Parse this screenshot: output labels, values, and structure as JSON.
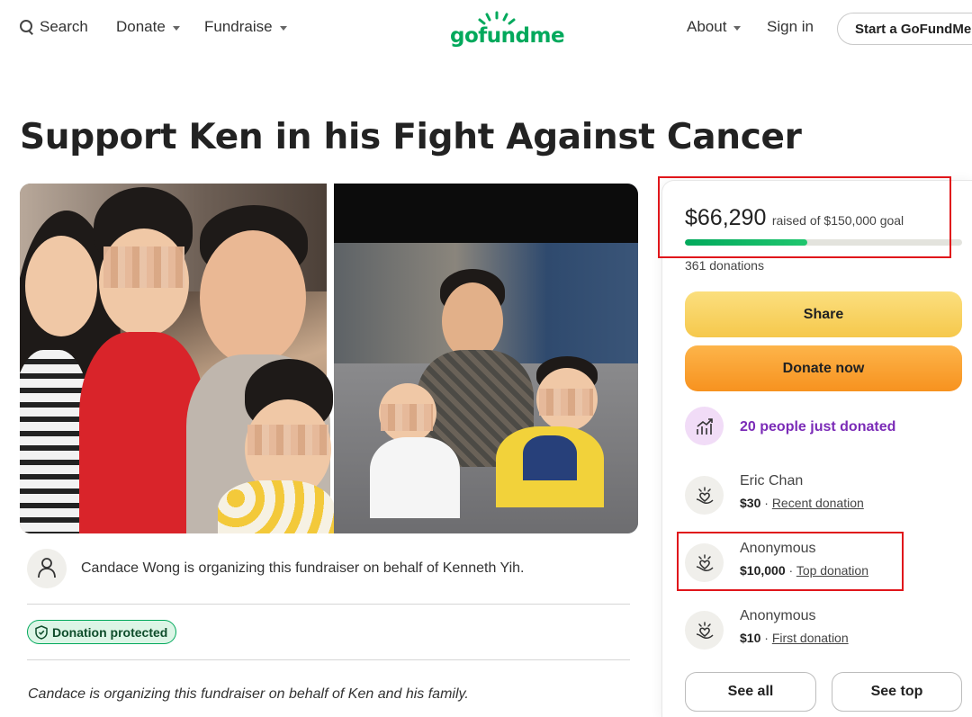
{
  "nav": {
    "search_label": "Search",
    "donate_label": "Donate",
    "fundraise_label": "Fundraise",
    "logo_text": "gofundme",
    "about_label": "About",
    "signin_label": "Sign in",
    "start_label": "Start a GoFundMe"
  },
  "page": {
    "title": "Support Ken in his Fight Against Cancer"
  },
  "organizer": {
    "text": "Candace Wong is organizing this fundraiser on behalf of Kenneth Yih."
  },
  "badge": {
    "label": "Donation protected"
  },
  "story": {
    "intro": "Candace is organizing this fundraiser on behalf of Ken and his family."
  },
  "fundraiser": {
    "raised": "$66,290",
    "raised_label": "raised of $150,000 goal",
    "progress_fraction": 0.442,
    "donations": "361 donations",
    "share_label": "Share",
    "donate_label": "Donate now",
    "just_donated": "20 people just donated"
  },
  "donors": [
    {
      "name": "Eric Chan",
      "amount": "$30",
      "separator": "·",
      "tag": "Recent donation"
    },
    {
      "name": "Anonymous",
      "amount": "$10,000",
      "separator": "·",
      "tag": "Top donation"
    },
    {
      "name": "Anonymous",
      "amount": "$10",
      "separator": "·",
      "tag": "First donation"
    }
  ],
  "footer_buttons": {
    "see_all": "See all",
    "see_top": "See top"
  },
  "colors": {
    "brand_green": "#02a95c",
    "share_yellow": "#f6c84c",
    "donate_orange": "#f7921f",
    "purple": "#7b2bb7",
    "highlight_red": "#e0161b"
  }
}
